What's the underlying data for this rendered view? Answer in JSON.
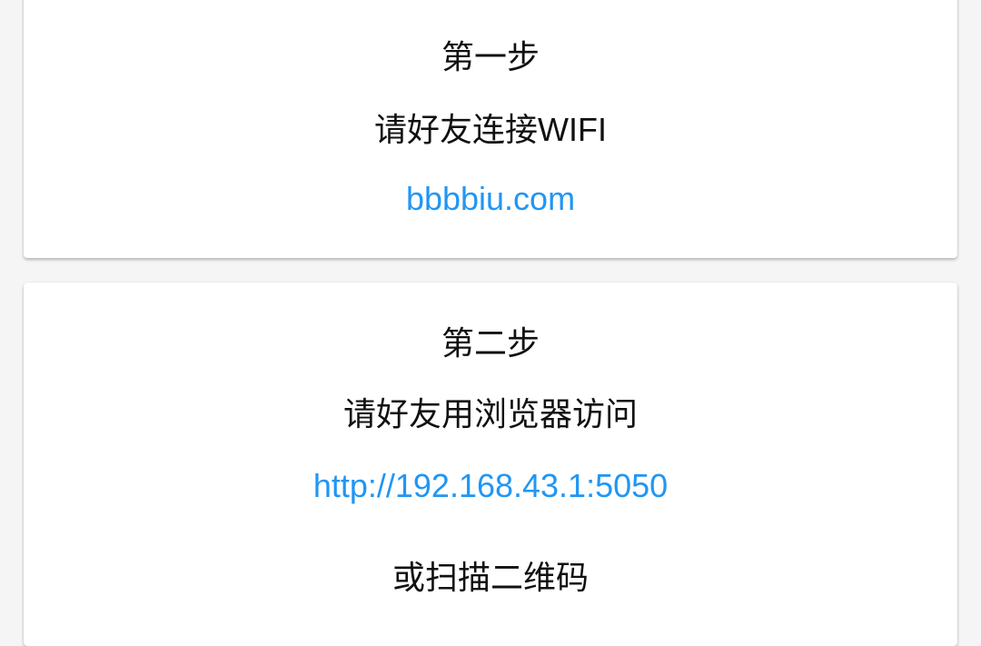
{
  "step1": {
    "title": "第一步",
    "instruction": "请好友连接WIFI",
    "wifi_name": "bbbbiu.com"
  },
  "step2": {
    "title": "第二步",
    "instruction": "请好友用浏览器访问",
    "url": "http://192.168.43.1:5050",
    "alt_instruction": "或扫描二维码"
  },
  "colors": {
    "link": "#2196f3",
    "background": "#f5f5f5"
  }
}
